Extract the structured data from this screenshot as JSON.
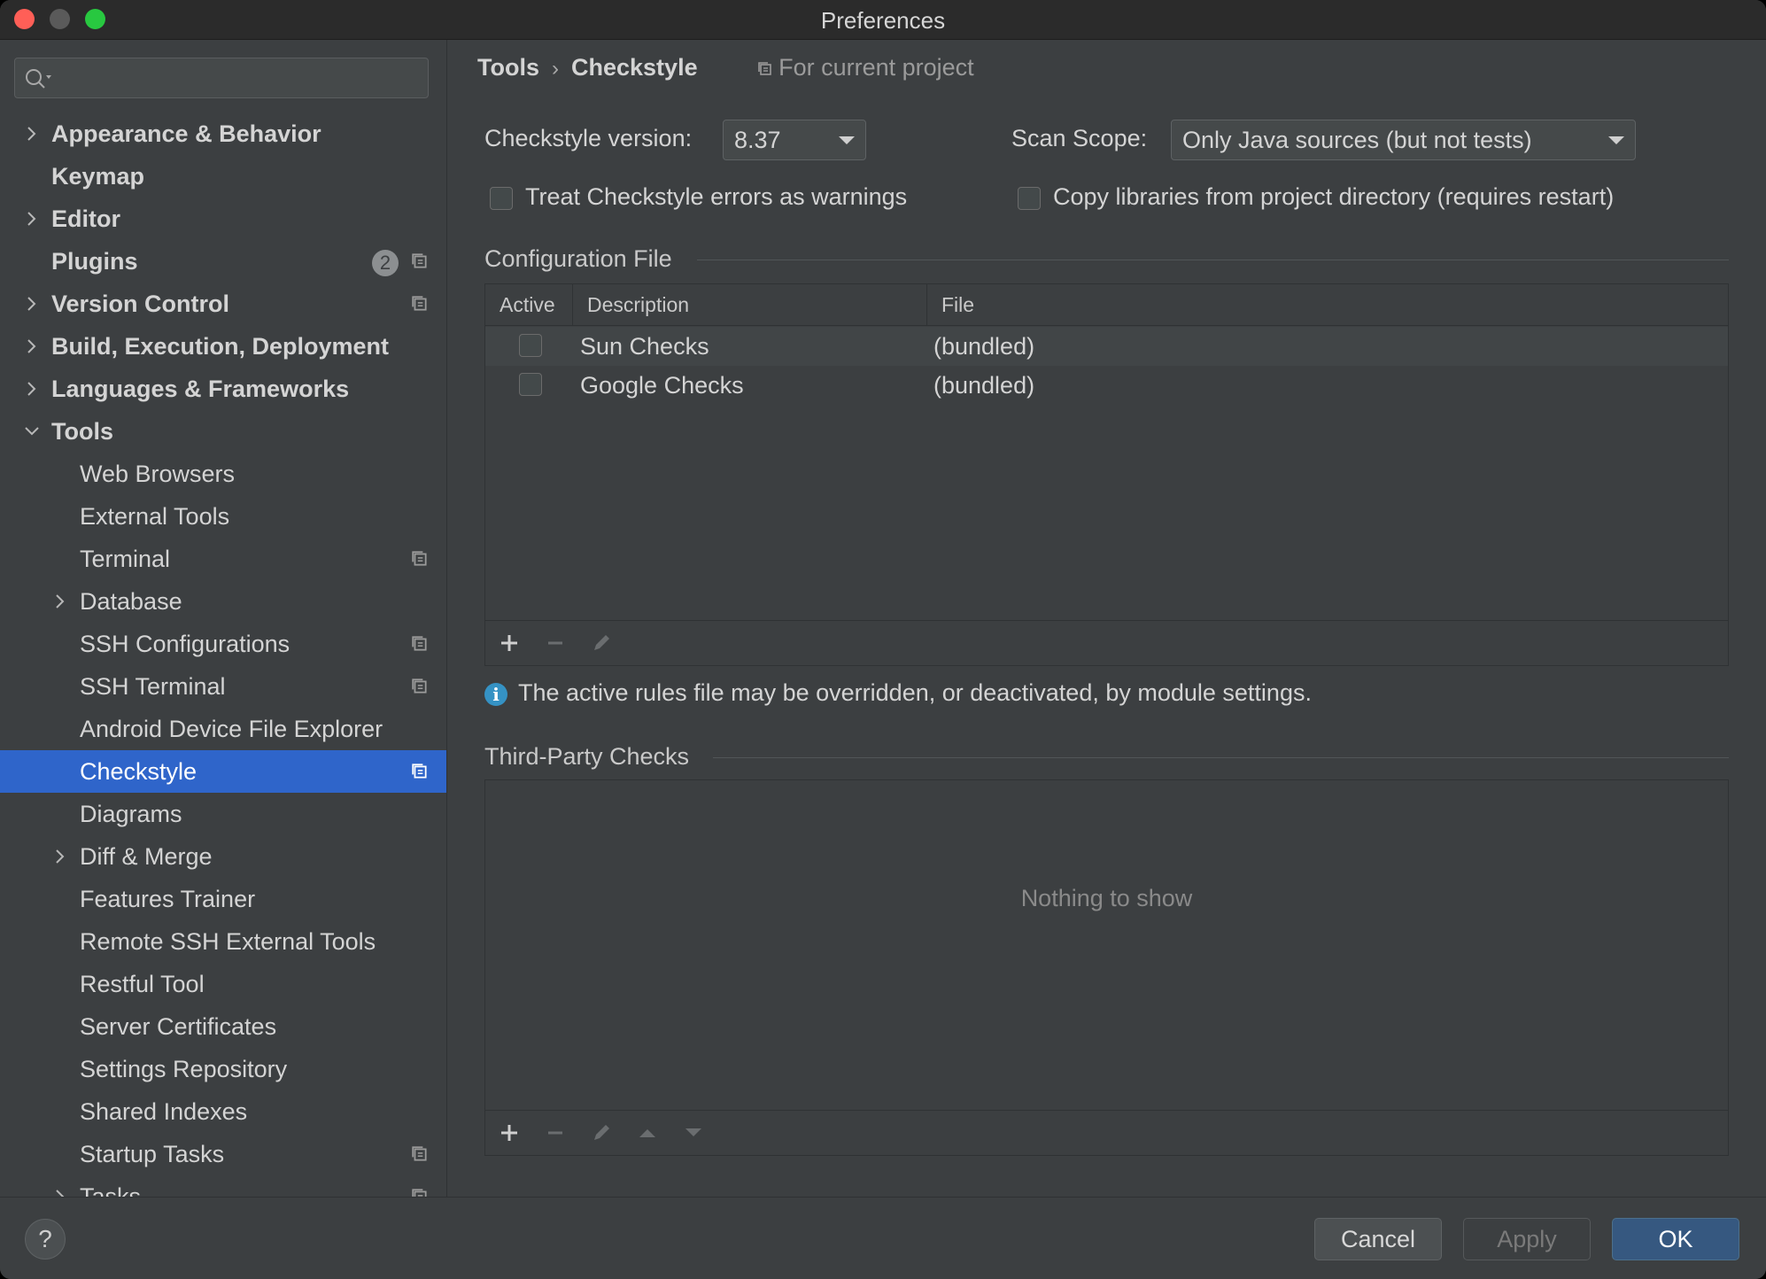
{
  "window": {
    "title": "Preferences"
  },
  "search": {
    "placeholder": ""
  },
  "sidebar": {
    "items": [
      {
        "label": "Appearance & Behavior",
        "bold": true,
        "expandable": true
      },
      {
        "label": "Keymap",
        "bold": true
      },
      {
        "label": "Editor",
        "bold": true,
        "expandable": true
      },
      {
        "label": "Plugins",
        "bold": true,
        "badge": "2",
        "project_icon": true
      },
      {
        "label": "Version Control",
        "bold": true,
        "expandable": true,
        "project_icon": true
      },
      {
        "label": "Build, Execution, Deployment",
        "bold": true,
        "expandable": true
      },
      {
        "label": "Languages & Frameworks",
        "bold": true,
        "expandable": true
      },
      {
        "label": "Tools",
        "bold": true,
        "expanded": true
      },
      {
        "label": "Web Browsers"
      },
      {
        "label": "External Tools"
      },
      {
        "label": "Terminal",
        "project_icon": true
      },
      {
        "label": "Database",
        "expandable": true
      },
      {
        "label": "SSH Configurations",
        "project_icon": true
      },
      {
        "label": "SSH Terminal",
        "project_icon": true
      },
      {
        "label": "Android Device File Explorer"
      },
      {
        "label": "Checkstyle",
        "selected": true,
        "project_icon": true
      },
      {
        "label": "Diagrams"
      },
      {
        "label": "Diff & Merge",
        "expandable": true
      },
      {
        "label": "Features Trainer"
      },
      {
        "label": "Remote SSH External Tools"
      },
      {
        "label": "Restful Tool"
      },
      {
        "label": "Server Certificates"
      },
      {
        "label": "Settings Repository"
      },
      {
        "label": "Shared Indexes"
      },
      {
        "label": "Startup Tasks",
        "project_icon": true
      },
      {
        "label": "Tasks",
        "expandable": true,
        "project_icon": true
      }
    ]
  },
  "breadcrumb": {
    "parent": "Tools",
    "current": "Checkstyle",
    "scope": "For current project"
  },
  "settings": {
    "version_label": "Checkstyle version:",
    "version_value": "8.37",
    "scope_label": "Scan Scope:",
    "scope_value": "Only Java sources (but not tests)",
    "treat_errors_label": "Treat Checkstyle errors as warnings",
    "copy_libs_label": "Copy libraries from project directory (requires restart)"
  },
  "config": {
    "title": "Configuration File",
    "columns": [
      "Active",
      "Description",
      "File"
    ],
    "rows": [
      {
        "description": "Sun Checks",
        "file": "(bundled)"
      },
      {
        "description": "Google Checks",
        "file": "(bundled)"
      }
    ]
  },
  "info_text": "The active rules file may be overridden, or deactivated, by module settings.",
  "third_party": {
    "title": "Third-Party Checks",
    "empty_text": "Nothing to show"
  },
  "footer": {
    "help": "?",
    "cancel": "Cancel",
    "apply": "Apply",
    "ok": "OK"
  },
  "colors": {
    "accent": "#2f65ca",
    "primary_button": "#365880",
    "background": "#3c3f41",
    "info": "#3592c4"
  }
}
